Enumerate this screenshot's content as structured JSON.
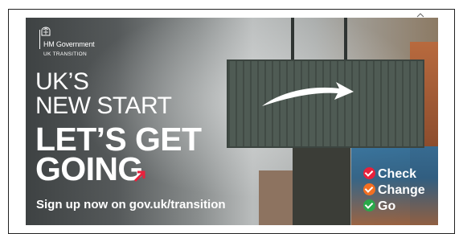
{
  "logo": {
    "org": "HM Government",
    "sub": "UK TRANSITION",
    "icon": "royal-crest-icon"
  },
  "headline": {
    "line1": "UK’S",
    "line2": "NEW START",
    "line3": "LET’S GET",
    "line4": "GOING"
  },
  "signup_text": "Sign up now on gov.uk/transition",
  "cta": [
    {
      "label": "Check",
      "color": "#e8213c"
    },
    {
      "label": "Change",
      "color": "#f36f21"
    },
    {
      "label": "Go",
      "color": "#2aa84a"
    }
  ],
  "colors": {
    "arrow_accent": "#e8213c",
    "container": "#4f5b54",
    "text": "#ffffff"
  }
}
